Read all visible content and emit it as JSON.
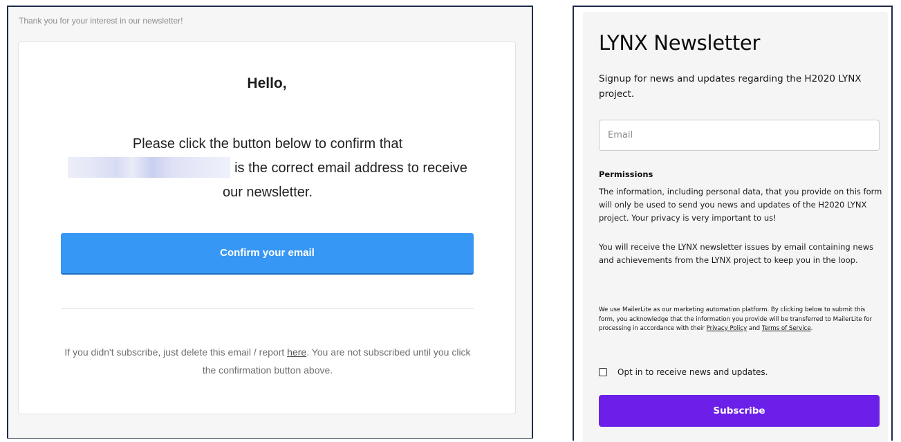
{
  "confirmation_email": {
    "preheader": "Thank you for your interest in our newsletter!",
    "greeting": "Hello,",
    "body_before": "Please click the button below to confirm that",
    "body_after": "is the correct email address to receive our newsletter.",
    "confirm_button": "Confirm your email",
    "footer_before": "If you didn't subscribe, just delete this email / report ",
    "footer_link": "here",
    "footer_after": ". You are not subscribed until you click the confirmation button above."
  },
  "signup_form": {
    "title": "LYNX Newsletter",
    "subtitle": "Signup for news and updates regarding the H2020 LYNX project.",
    "email_placeholder": "Email",
    "email_value": "",
    "permissions_heading": "Permissions",
    "permissions_text_1": "The information, including personal data, that you provide on this form will only be used to send you news and updates of the H2020 LYNX project. Your privacy is very important to us!",
    "permissions_text_2": "You will receive the LYNX newsletter issues by email containing news and achievements from the LYNX project to keep you in the loop.",
    "legal_before": "We use MailerLite as our marketing automation platform. By clicking below to submit this form, you acknowledge that the information you provide will be transferred to MailerLite for processing in accordance with their ",
    "privacy_link": "Privacy Policy",
    "legal_and": " and ",
    "terms_link": "Terms of Service",
    "legal_end": ".",
    "optin_label": "Opt in to receive news and updates.",
    "optin_checked": false,
    "subscribe_button": "Subscribe"
  },
  "colors": {
    "confirm_button": "#3797f5",
    "subscribe_button": "#6b1fe8",
    "frame_border": "#1e2a4a"
  }
}
